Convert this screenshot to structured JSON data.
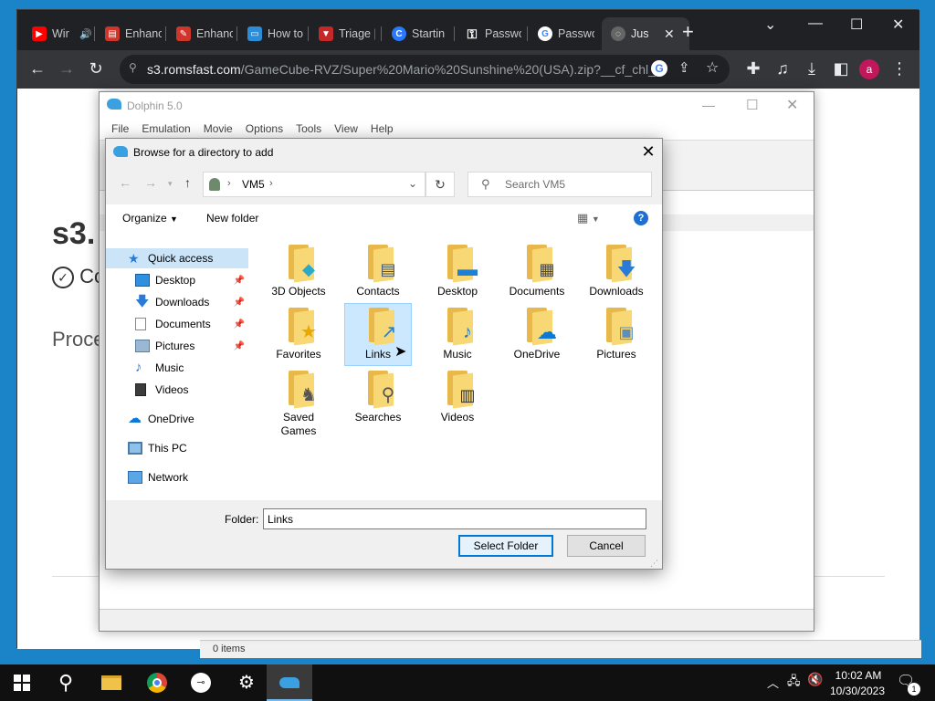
{
  "browser": {
    "tabs": [
      {
        "title": "Wir",
        "favicon": "youtube-icon",
        "color": "#ff0000"
      },
      {
        "title": "Enhanc",
        "favicon": "page-icon",
        "color": "#d0352b"
      },
      {
        "title": "Enhanc",
        "favicon": "pen-icon",
        "color": "#d0352b"
      },
      {
        "title": "How to",
        "favicon": "monitor-icon",
        "color": "#2b8cd8"
      },
      {
        "title": "Triage |",
        "favicon": "triage-icon",
        "color": "#c62828"
      },
      {
        "title": "Startin",
        "favicon": "c-icon",
        "color": "#2979ff"
      },
      {
        "title": "Passwo",
        "favicon": "key-icon",
        "color": "#ffffff"
      },
      {
        "title": "Passwo",
        "favicon": "google-icon",
        "color": "#4285f4"
      },
      {
        "title": "Jus",
        "favicon": "loading-icon",
        "color": "#888888"
      }
    ],
    "url_host": "s3.romsfast.com",
    "url_path": "/GameCube-RVZ/Super%20Mario%20Sunshine%20(USA).zip?__cf_chl_...",
    "avatar_letter": "a"
  },
  "page": {
    "heading_fragment": "s3.",
    "check_fragment": "Co",
    "proceed_fragment": "Proce",
    "status_fragment": "0 items"
  },
  "dolphin": {
    "title": "Dolphin 5.0",
    "menu": [
      "File",
      "Emulation",
      "Movie",
      "Options",
      "Tools",
      "View",
      "Help"
    ]
  },
  "dialog": {
    "title": "Browse for a directory to add",
    "breadcrumb": "VM5",
    "search_placeholder": "Search VM5",
    "organize_label": "Organize",
    "new_folder_label": "New folder",
    "nav": [
      {
        "label": "Quick access",
        "icon": "star-icon",
        "selected": true
      },
      {
        "label": "Desktop",
        "icon": "desktop-icon",
        "pinned": true
      },
      {
        "label": "Downloads",
        "icon": "download-icon",
        "pinned": true
      },
      {
        "label": "Documents",
        "icon": "document-icon",
        "pinned": true
      },
      {
        "label": "Pictures",
        "icon": "picture-icon",
        "pinned": true
      },
      {
        "label": "Music",
        "icon": "music-icon"
      },
      {
        "label": "Videos",
        "icon": "video-icon"
      },
      {
        "label": "OneDrive",
        "icon": "cloud-icon"
      },
      {
        "label": "This PC",
        "icon": "computer-icon"
      },
      {
        "label": "Network",
        "icon": "network-icon"
      }
    ],
    "folders": [
      {
        "label": "3D Objects",
        "overlay": "cube-icon"
      },
      {
        "label": "Contacts",
        "overlay": "contact-card-icon"
      },
      {
        "label": "Desktop",
        "overlay": "desktop-icon"
      },
      {
        "label": "Documents",
        "overlay": "document-icon"
      },
      {
        "label": "Downloads",
        "overlay": "download-arrow-icon"
      },
      {
        "label": "Favorites",
        "overlay": "star-icon"
      },
      {
        "label": "Links",
        "overlay": "shortcut-arrow-icon",
        "selected": true
      },
      {
        "label": "Music",
        "overlay": "music-note-icon"
      },
      {
        "label": "OneDrive",
        "overlay": "cloud-icon"
      },
      {
        "label": "Pictures",
        "overlay": "picture-icon"
      },
      {
        "label": "Saved Games",
        "overlay": "chess-icon"
      },
      {
        "label": "Searches",
        "overlay": "magnifier-icon"
      },
      {
        "label": "Videos",
        "overlay": "film-icon"
      }
    ],
    "folder_label": "Folder:",
    "folder_value": "Links",
    "select_button": "Select Folder",
    "cancel_button": "Cancel"
  },
  "taskbar": {
    "time": "10:02 AM",
    "date": "10/30/2023",
    "notification_count": "1"
  }
}
